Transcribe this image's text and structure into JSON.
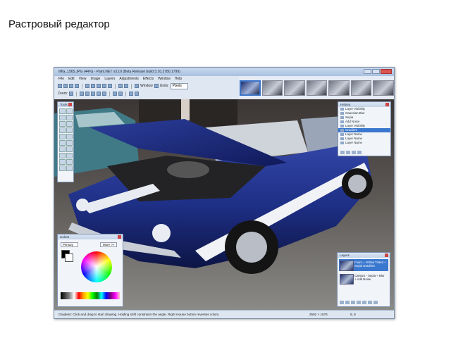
{
  "slide": {
    "title": "Растровый редактор"
  },
  "window": {
    "title": "IMG_1565.JPG (44%) - Paint.NET v3.10 (Beta Release build 3.10.2780.1799)"
  },
  "menu": [
    "File",
    "Edit",
    "View",
    "Image",
    "Layers",
    "Adjustments",
    "Effects",
    "Window",
    "Help"
  ],
  "toolbar": {
    "zoom_label": "Zoom:",
    "window_label": "Window",
    "units_label": "Units:",
    "units_value": "Pixels"
  },
  "tools_panel": {
    "title": "Tools"
  },
  "history_panel": {
    "title": "History",
    "items": [
      "Layer Visibility",
      "Gaussian Blur",
      "Sepia",
      "Add Noise",
      "Layer Visibility",
      "Gradient",
      "Layer Name",
      "Layer Name",
      "Layer Name"
    ],
    "selected_index": 5
  },
  "colors_panel": {
    "title": "Colors",
    "mode_value": "Primary",
    "more_label": "More >>"
  },
  "layers_panel": {
    "title": "Layers",
    "items": [
      {
        "name": "Foam = Yellow Tinted + Sepia Gradient",
        "selected": true
      },
      {
        "name": "Camaro - Sepia + Blur + Add Noise",
        "selected": false
      }
    ]
  },
  "statusbar": {
    "message": "Gradient: Click and drag to start drawing. Holding shift constrains the angle. Right mouse button reverses colors.",
    "size": "2592 × 1576",
    "position": "6, 9"
  },
  "colors": {
    "selection_blue": "#3a78cf",
    "car_blue": "#1e2f86"
  }
}
